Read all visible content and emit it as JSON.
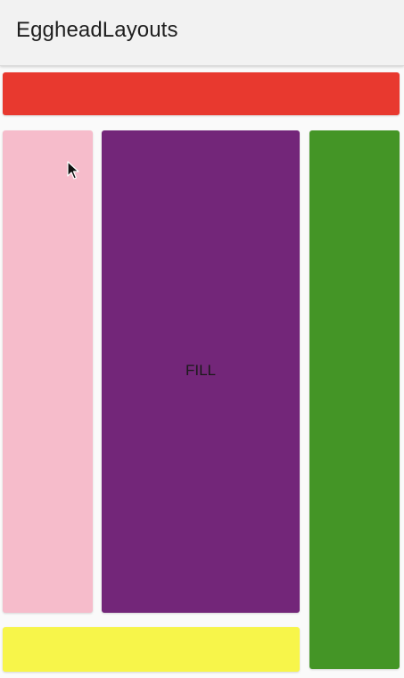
{
  "app_bar": {
    "title": "EggheadLayouts"
  },
  "boxes": {
    "red": {
      "color": "#e8392f"
    },
    "pink": {
      "color": "#f6bccb"
    },
    "purple": {
      "color": "#732679",
      "label": "FILL"
    },
    "green": {
      "color": "#449526"
    },
    "yellow": {
      "color": "#f7f54a"
    }
  },
  "icons": {
    "cursor": "mouse-pointer-icon"
  }
}
